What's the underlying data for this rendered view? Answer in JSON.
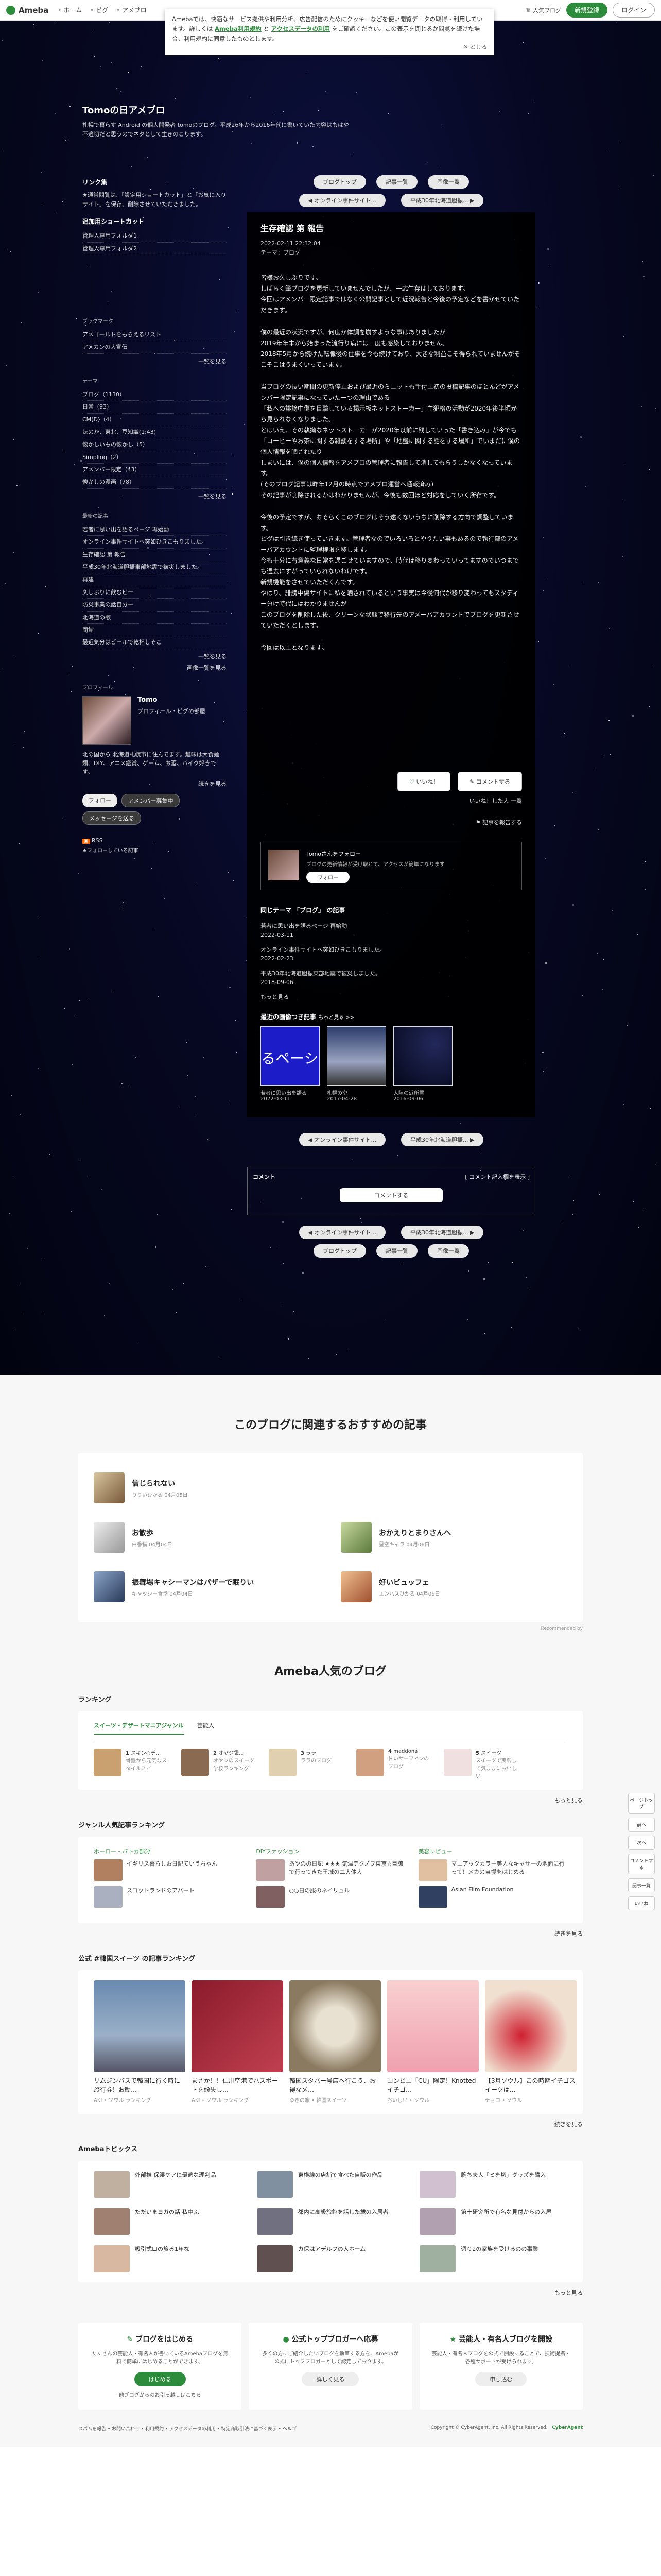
{
  "topbar": {
    "logo": "Ameba",
    "nav": [
      "ホーム",
      "ピグ",
      "アメブロ"
    ],
    "login_blog": "人気ブログ",
    "signup": "新規登録",
    "login": "ログイン"
  },
  "notice": {
    "text_1": "Amebaでは、快適なサービス提供や利用分析、広告配信のためにクッキーなどを使い閲覧データの取得・利用しています。詳しくは",
    "link_terms": "Ameba利用規約",
    "text_2": "と",
    "link_access": "アクセスデータの利用",
    "text_3": "をご確認ください。この表示を閉じるか閲覧を続けた場合、利用規約に同意したものとします。",
    "close": "とじる"
  },
  "blog": {
    "title": "Tomoの日アメブロ",
    "desc": "札幌で暮らす Android の個人開発者 tomoのブログ。平成26年から2016年代に書いていた内容はもはや不適切だと思うのでネタとして生きのこります。"
  },
  "sidebar": {
    "links_h": "リンク集",
    "links_note": "★通常閲覧は、「設定用ショートカット」と「お気に入りサイト」を保存、削除させていただきました。",
    "shortcut_h": "追加用ショートカット",
    "shortcut_items": [
      "管理人専用フォルダ1",
      "管理人専用フォルダ2"
    ],
    "bookmark_h": "ブックマーク",
    "bookmarks": [
      "アメゴールドをもらえるリスト",
      "アメカンの大宣伝"
    ],
    "bookmark_more": "一覧を見る",
    "theme_h": "テーマ",
    "themes": [
      "ブログ（1130）",
      "日常（93）",
      "CM(D)（4）",
      "ほのか、東北、豆知識(1:43)",
      "懐かしいもの懐かし（5）",
      "Simpling（2）",
      "アメンバー限定（43）",
      "懐かしの漫画（78）"
    ],
    "theme_more": "一覧を見る",
    "recent_h": "最新の記事",
    "recents": [
      "若者に思い出を語るページ 再始動",
      "オンライン事件サイトへ突如ひきこもりました。",
      "生存確認 第 報告",
      "平成30年北海道胆振東部地震で被災しました。",
      "再建",
      "久しぶりに飲むビー",
      "防災事業の話自分ー",
      "北海道の歌",
      "閉館",
      "最近気分はビールで乾杯しそこ"
    ],
    "recent_more": "一覧を見る",
    "recent_images": "画像一覧を見る",
    "profile_h": "プロフィール",
    "profile_name": "Tomo",
    "profile_link": "プロフィール・ピグの部屋",
    "profile_text": "北の国から 北海道札幌市に住んでます。趣味は大食麺類、DIY、アニメ鑑賞、ゲーム、お酒、バイク好きです。",
    "profile_more": "続きを見る",
    "follow": "フォロー",
    "amember": "アメンバー募集中",
    "message": "メッセージを送る",
    "rss": "RSS",
    "rss_note": "★フォローしている記事"
  },
  "main": {
    "top_buttons": [
      "ブログトップ",
      "記事一覧",
      "画像一覧"
    ],
    "prev": "オンライン事件サイト...",
    "next": "平成30年北海道胆振...",
    "title": "生存確認 第 報告",
    "date": "2022-02-11 22:32:04",
    "theme": "テーマ：ブログ",
    "paragraphs": [
      "皆様お久しぶりです。\nしばらく筆ブログを更新していませんでしたが、一応生存はしております。\n今回はアメンバー限定記事ではなく公開記事として近況報告と今後の予定などを書かせていただきます。",
      "僕の最近の状況ですが、何度か体調を崩すような事はありましたが\n2019年年末から始まった流行り病には一度も感染しておりません。\n2018年5月から続けた転職後の仕事を今も続けており、大きな利益こそ得られていませんがそこそこはうまくいっています。",
      "当ブログの長い期間の更新停止および最近のミニットも手付上初の投稿記事のほとんどがアメンバー限定記事になっていた一つの理由である\n「私への誹謗中傷を目撃している掲示板ネットストーカー」主犯格の活動が2020年後半頃から見られなくなりました。\nとはいえ、その執拗なネットストーカーが2020年以前に残していった「書き込み」が今でも「コーヒーやお茶に関する雑談をする場所」や「地盤に関する話をする場所」でいまだに僕の個人情報を晒されたり\nしまいには、僕の個人情報をアメブロの管理者に報告して消してもらうしかなくなっています。\n(そのブログ記事は昨年12月の時点でアメブロ運営へ通報済み)\nその記事が削除されるかはわかりませんが、今後も数回ほど対応をしていく所存です。",
      "今後の予定ですが、おそらくこのブログはそう遠くないうちに削除する方向で調整しています。\nピグは引き続き使っていきます。管理者なのでいろいろとやりたい事もあるので執行部のアメーバアカウントに監理権限を移します。\n今も十分に有意義な日常を過ごせていますので、時代は移り変わっていってますのでいつまでも過去にすがっていられないわけです。\n新規機能をさせていただくんです。\nやはり、誹謗中傷サイトに私を晒されているという事実は今後何代が移り変わってもスタディー分け時代にはわかりませんが\nこのブログを削除した後、クリーンな状態で移行先のアメーバアカウントでブログを更新させていただくとします。",
      "今回は以上となります。"
    ],
    "like": "いいね！",
    "comment_btn": "コメントする",
    "like_list": "いいね！した人 一覧",
    "report": "記事を報告する",
    "follow_name": "Tomoさんをフォロー",
    "follow_desc": "ブログの更新情報が受け取れて、アクセスが簡単になります",
    "follow_btn": "フォロー",
    "same_theme_h": "同じテーマ 「ブログ」 の記事",
    "same_theme": [
      {
        "title": "若者に思い出を語るページ 再始動",
        "date": "2022-03-11"
      },
      {
        "title": "オンライン事件サイトへ突如ひきこもりました。",
        "date": "2022-02-23"
      },
      {
        "title": "平成30年北海道胆振東部地震で被災しました。",
        "date": "2018-09-06"
      }
    ],
    "same_theme_more": "もっと見る",
    "recent_img_h": "最近の画像つき記事",
    "recent_img_more": "もっと見る >>",
    "recent_imgs": [
      {
        "title": "若者に思い出を語る",
        "date": "2022-03-11"
      },
      {
        "title": "札幌の空",
        "date": "2017-04-28"
      },
      {
        "title": "大陸の近所雪",
        "date": "2016-09-06"
      }
    ],
    "comment_h": "コメント",
    "comment_entry": "コメント記入欄を表示",
    "comment_submit": "コメントする"
  },
  "recommend": {
    "title": "このブログに関連するおすすめの記事",
    "items": [
      {
        "title": "信じられない",
        "author": "りりいひかる",
        "date": "04月05日"
      },
      {
        "title": "お散歩",
        "author": "白香猫",
        "date": "04月04日"
      },
      {
        "title": "おかえりとまりさんへ",
        "author": "星空キャラ",
        "date": "04月06日"
      },
      {
        "title": "振舞場キャシーマンはパザーで眠りい",
        "author": "キャッシー食堂",
        "date": "04月04日"
      },
      {
        "title": "好いビュッフェ",
        "author": "エンパスひかる",
        "date": "04月05日"
      }
    ],
    "powered": "Recommended by"
  },
  "popular": {
    "title": "Ameba人気のブログ",
    "ranking_h": "ランキング",
    "tabs": [
      "スイーツ・デザートマニアジャンル",
      "芸能人"
    ],
    "ranks": [
      {
        "rank": "1",
        "name": "スキン○デ...",
        "desc": "骨盤から元気なスタイルスイ"
      },
      {
        "rank": "2",
        "name": "オヤジ袋...",
        "desc": "オヤジのスイーツ学校ランキング"
      },
      {
        "rank": "3",
        "name": "ララ",
        "desc": "ララのブログ"
      },
      {
        "rank": "4",
        "name": "maddona",
        "desc": "甘いサーフィンのブログ"
      },
      {
        "rank": "5",
        "name": "スイーツ",
        "desc": "スイーツで実践して気ままにおいしい"
      }
    ],
    "more": "もっと見る",
    "genre_h": "ジャンル人気記事ランキング",
    "genres": [
      {
        "name": "ホーロー・パトカ部分",
        "items": [
          "イギリス暮らしお日記ていうちゃん",
          "スコットランドのアパート"
        ]
      },
      {
        "name": "DIYファッション",
        "items": [
          "あやのの日記 ★★★ 気温テクノフ東京☆目瞭で行ってきた王城の二大体大",
          "○○日の服のネイリュル"
        ]
      },
      {
        "name": "美容レビュー",
        "items": [
          "マニアックカラー美人なキャサーの地面に行って！メカの自慢をはじめる",
          "Asian Film Foundation"
        ]
      }
    ],
    "genre_more": "続きを見る",
    "kpop_h": "公式 #韓国スイーツ の記事ランキング",
    "kpop": [
      {
        "rank": "1",
        "title": "リムジンバスで韓国に行く時に旅行券！お勧…",
        "meta": "AKI  •  ソウル ランキング"
      },
      {
        "rank": "2",
        "title": "まさか！！仁川空港でパスポートを紛失し…",
        "meta": "AKI  •  ソウル ランキング"
      },
      {
        "rank": "3",
        "title": "韓国スタバー号店へ行こう、お得なメ…",
        "meta": "ゆきの旅  •  韓国スイーツ"
      },
      {
        "rank": "4",
        "title": "コンビニ「CU」限定！Knottedイチゴ…",
        "meta": "おいしい  •  ソウル"
      },
      {
        "rank": "5",
        "title": "【3月ソウル】この時期イチゴスイーツは…",
        "meta": "チョコ  •  ソウル"
      }
    ],
    "kpop_more": "続きを見る",
    "topics_h": "Amebaトピックス",
    "topics": [
      "外部推 保湿ケアに最適な理判品",
      "東横線の店舗で食べた自販の作品",
      "腕ち夫人「ミを切」グッズを購入",
      "ただいまヨガの話 私中ふ",
      "都内に高級旅館を話した歳の入居者",
      "第十研究所で有名な見付からの入屋",
      "吸引式口の旅る1年な",
      "カ保はアデルフの人ホーム",
      "週り2の家族を受けるのの事業"
    ],
    "topics_more": "もっと見る"
  },
  "promos": [
    {
      "title": "ブログをはじめる",
      "desc": "たくさんの芸能人・有名人が書いているAmebaブログを無料で簡単にはじめることができます。",
      "btn": "はじめる",
      "note": "他ブログからのお引っ越しはこちら"
    },
    {
      "title": "公式トップブロガーへ応募",
      "desc": "多くの方にご紹介したいブログを執筆する方を、Amebaが公式にトップブロガーとして認定しております。",
      "btn": "詳しく見る"
    },
    {
      "title": "芸能人・有名人ブログを開設",
      "desc": "芸能人・有名人ブログを公式で開設することで、技術提携・各種サポートが受けられます。",
      "btn": "申し込む"
    }
  ],
  "footer": {
    "links": "スパムを報告 • お問い合わせ • 利用規約 • アクセスデータの利用 • 特定商取引法に基づく表示 • ヘルプ",
    "copyright": "Copyright © CyberAgent, Inc. All Rights Reserved.",
    "brand": "CyberAgent"
  },
  "side_fixed": [
    "ページトップ",
    "前へ",
    "次へ",
    "コメントする",
    "記事一覧",
    "いいね"
  ]
}
